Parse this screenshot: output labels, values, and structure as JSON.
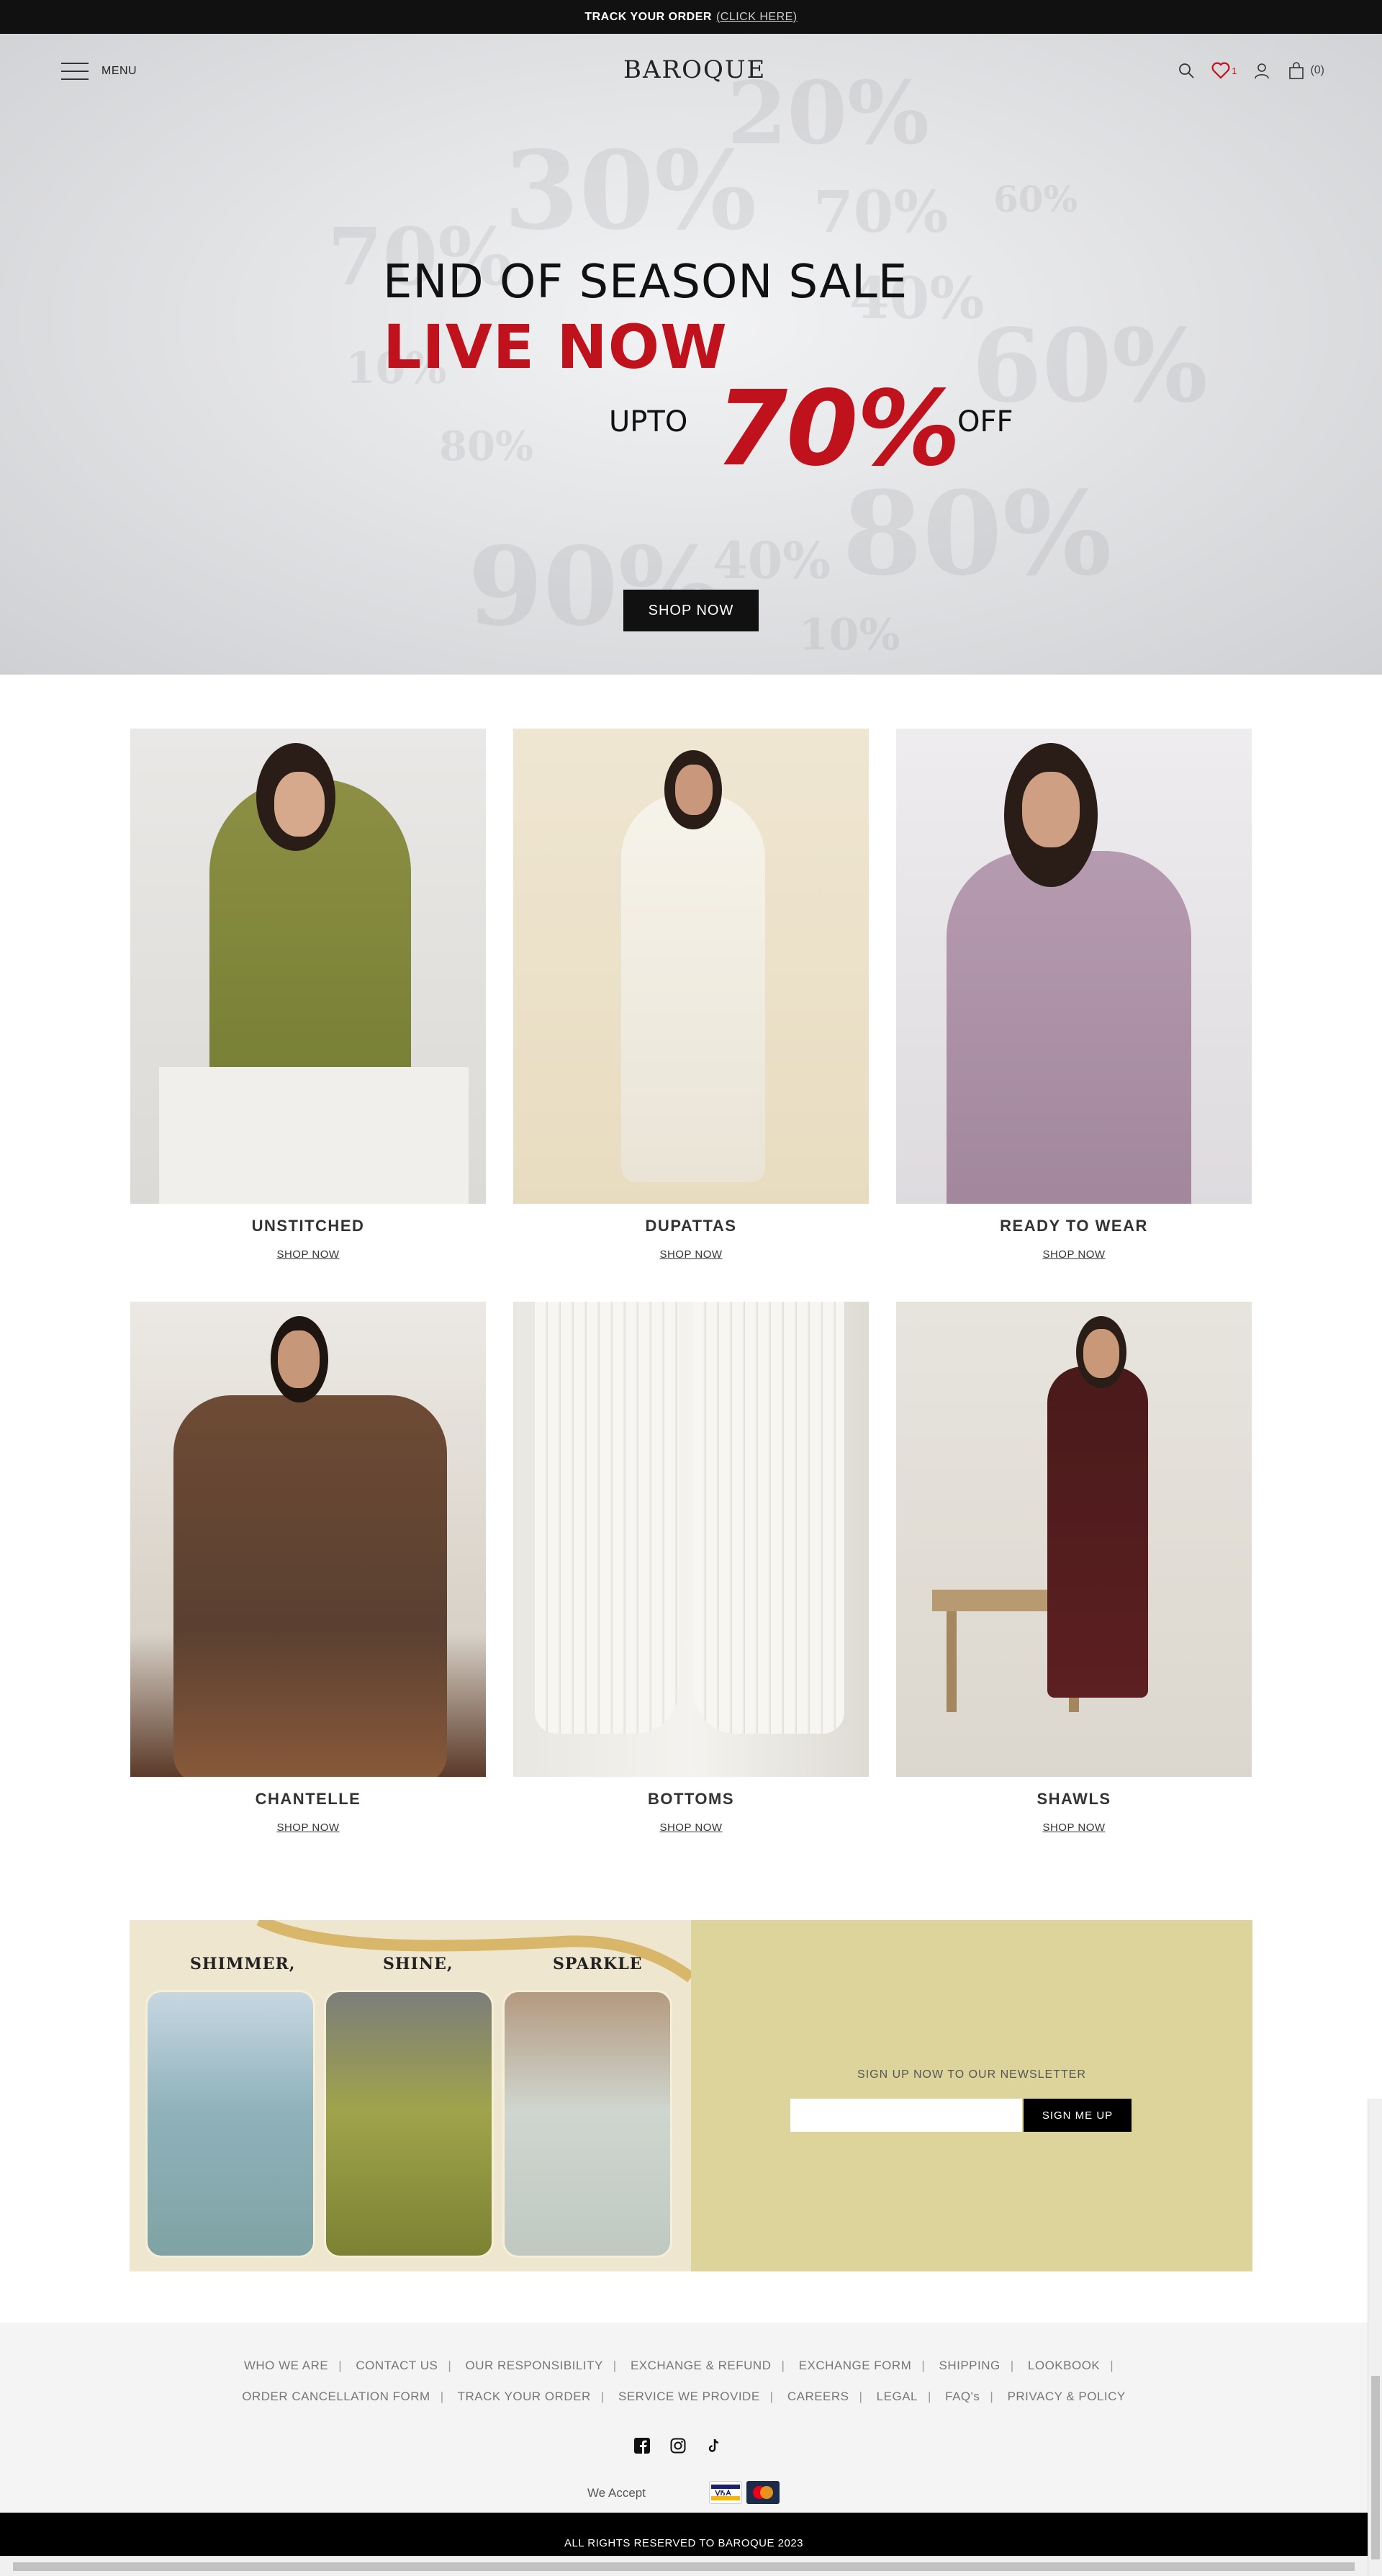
{
  "topbar": {
    "text": "TRACK YOUR ORDER",
    "link": "(CLICK HERE)"
  },
  "header": {
    "menu_label": "MENU",
    "logo": "BAROQUE",
    "wishlist_count": "1",
    "cart_count": "(0)"
  },
  "hero": {
    "title": "END OF SEASON SALE",
    "live": "LIVE NOW",
    "upto": "UPTO",
    "percent": "70%",
    "off": "OFF",
    "button": "SHOP NOW",
    "background_percents": [
      "20%",
      "30%",
      "70%",
      "60%",
      "70%",
      "40%",
      "10%",
      "60%",
      "80%",
      "80%",
      "90%",
      "40%",
      "10%"
    ]
  },
  "categories": [
    {
      "name": "UNSTITCHED",
      "link": "SHOP NOW"
    },
    {
      "name": "DUPATTAS",
      "link": "SHOP NOW"
    },
    {
      "name": "READY TO WEAR",
      "link": "SHOP NOW"
    },
    {
      "name": "CHANTELLE",
      "link": "SHOP NOW"
    },
    {
      "name": "BOTTOMS",
      "link": "SHOP NOW"
    },
    {
      "name": "SHAWLS",
      "link": "SHOP NOW"
    }
  ],
  "newsletter": {
    "words": [
      "SHIMMER,",
      "SHINE,",
      "SPARKLE"
    ],
    "title": "SIGN UP NOW TO OUR NEWSLETTER",
    "placeholder": "",
    "button": "SIGN ME UP"
  },
  "footer": {
    "row1": [
      "WHO WE ARE",
      "CONTACT US",
      "OUR RESPONSIBILITY",
      "EXCHANGE & REFUND",
      "EXCHANGE FORM",
      "SHIPPING",
      "LOOKBOOK"
    ],
    "row2": [
      "ORDER CANCELLATION FORM",
      "TRACK YOUR ORDER",
      "SERVICE WE PROVIDE",
      "CAREERS",
      "LEGAL",
      "FAQ's",
      "PRIVACY & POLICY"
    ],
    "we_accept": "We Accept",
    "copyright": "ALL RIGHTS RESERVED TO BAROQUE 2023"
  },
  "colors": {
    "accent_red": "#c0121c",
    "newsletter_bg": "#ddd49c",
    "dark": "#111111"
  }
}
